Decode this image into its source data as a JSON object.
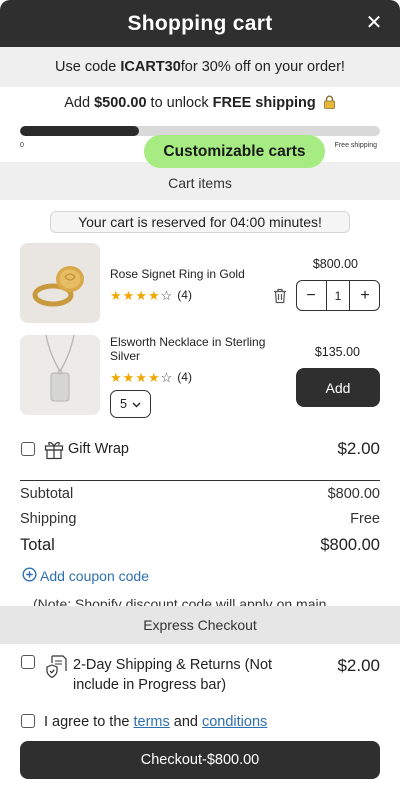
{
  "header": {
    "title": "Shopping cart",
    "close_label": "✕"
  },
  "promo": {
    "prefix": "Use code ",
    "code": "ICART30",
    "suffix": " for 30% off on your order!"
  },
  "shipping_goal": {
    "prefix": "Add ",
    "amount": "$500.00",
    "middle": " to unlock ",
    "highlight": "FREE shipping",
    "progress_fraction": 0.33,
    "min_label": "0",
    "max_label": "Free shipping"
  },
  "badge": {
    "label": "Customizable carts"
  },
  "cart_items_header": "Cart items",
  "reservation": {
    "text": "Your cart is reserved for 04:00 minutes!"
  },
  "items": [
    {
      "name": "Rose Signet Ring in Gold",
      "rating": 4,
      "review_count": "(4)",
      "price": "$800.00",
      "quantity": "1",
      "minus": "−",
      "plus": "+",
      "icon": "trash-icon"
    },
    {
      "name": "Elsworth Necklace in Sterling Silver",
      "rating": 4,
      "review_count": "(4)",
      "price": "$135.00",
      "variant": "5",
      "add_label": "Add"
    }
  ],
  "gift_wrap": {
    "label": "Gift Wrap",
    "price": "$2.00"
  },
  "summary": {
    "subtotal_label": "Subtotal",
    "subtotal_value": "$800.00",
    "shipping_label": "Shipping",
    "shipping_value": "Free",
    "total_label": "Total",
    "total_value": "$800.00"
  },
  "coupon": {
    "label": "Add coupon code"
  },
  "note": {
    "text": "(Note: Shopify discount code will apply on main"
  },
  "express_checkout": {
    "label": "Express Checkout"
  },
  "shipping_protection": {
    "label": "2-Day Shipping & Returns (Not include in Progress bar)",
    "price": "$2.00"
  },
  "terms": {
    "prefix": "I agree to the ",
    "terms_link": "terms",
    "and": " and ",
    "conditions_link": "conditions"
  },
  "checkout": {
    "label": "Checkout-$800.00"
  },
  "colors": {
    "accent": "#2f2f2f",
    "badge": "#a6ec83",
    "link": "#2f6fb0",
    "star": "#f0a800"
  }
}
